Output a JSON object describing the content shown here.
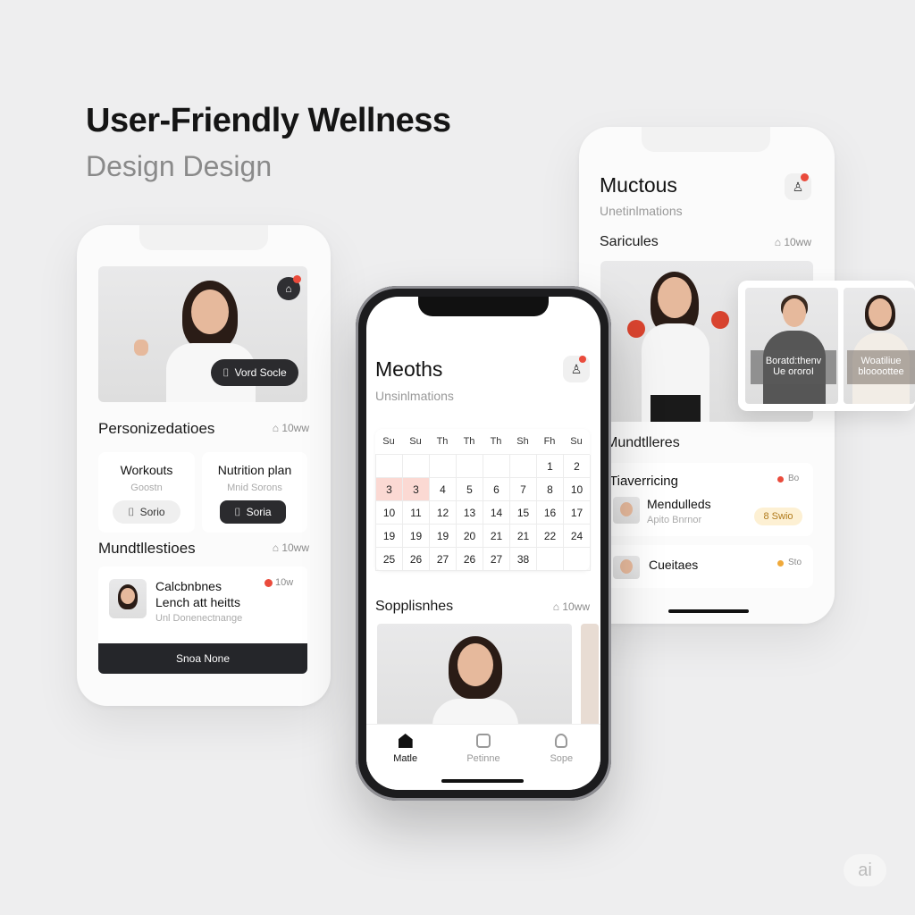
{
  "hero": {
    "title": "User-Friendly Wellness",
    "subtitle": "Design Design"
  },
  "left_phone": {
    "photo_button": "Vord Socle",
    "section1_title": "Personizedatioes",
    "section1_meta": "10ww",
    "cards": [
      {
        "title": "Workouts",
        "sub": "Goostn",
        "button": "Sorio",
        "style": "light"
      },
      {
        "title": "Nutrition plan",
        "sub": "Mnid Sorons",
        "button": "Soria",
        "style": "dark"
      }
    ],
    "section2_title": "Mundtllestioes",
    "section2_meta": "10ww",
    "entry": {
      "line1": "Calcbnbnes",
      "line2": "Lench att heitts",
      "line3": "Unl Donenectnange",
      "meta": "10w"
    },
    "bottom_button": "Snoa None"
  },
  "center_phone": {
    "title": "Meoths",
    "subtitle": "Unsinlmations",
    "calendar": {
      "headers": [
        "Su",
        "Su",
        "Th",
        "Th",
        "Th",
        "Sh",
        "Fh",
        "Su"
      ],
      "rows": [
        [
          "",
          "",
          "",
          "",
          "",
          "",
          "1",
          "2"
        ],
        [
          "3",
          "3",
          "4",
          "5",
          "6",
          "7",
          "8",
          "10"
        ],
        [
          "10",
          "11",
          "12",
          "13",
          "14",
          "15",
          "16",
          "17"
        ],
        [
          "19",
          "19",
          "19",
          "20",
          "21",
          "21",
          "22",
          "24"
        ],
        [
          "25",
          "26",
          "27",
          "26",
          "27",
          "38",
          "",
          ""
        ]
      ]
    },
    "section_title": "Sopplisnhes",
    "section_meta": "10ww",
    "tabs": [
      "Matle",
      "Petinne",
      "Sope"
    ]
  },
  "right_phone": {
    "title": "Muctous",
    "subtitle": "Unetinlmations",
    "section1_title": "Saricules",
    "section1_meta": "10ww",
    "overlay_labels": [
      {
        "l1": "Boratd:thenv",
        "l2": "Ue ororoI"
      },
      {
        "l1": "Woatiliue",
        "l2": "bloooottee"
      }
    ],
    "section2_title": "Mundtlleres",
    "card1": {
      "heading": "Tiaverricing",
      "meta": "Bo",
      "name": "Mendulleds",
      "sub": "Apito Bnrnor",
      "badge": "8 Swio"
    },
    "card2": {
      "name": "Cueitaes",
      "meta": "Sto"
    }
  },
  "watermark": "ai",
  "colors": {
    "background": "#eeeeef",
    "accent_red": "#ea4b3c",
    "dark": "#2b2b2e",
    "calendar_highlight": "#fbd9d3",
    "badge_yellow": "#fdf0d3"
  }
}
